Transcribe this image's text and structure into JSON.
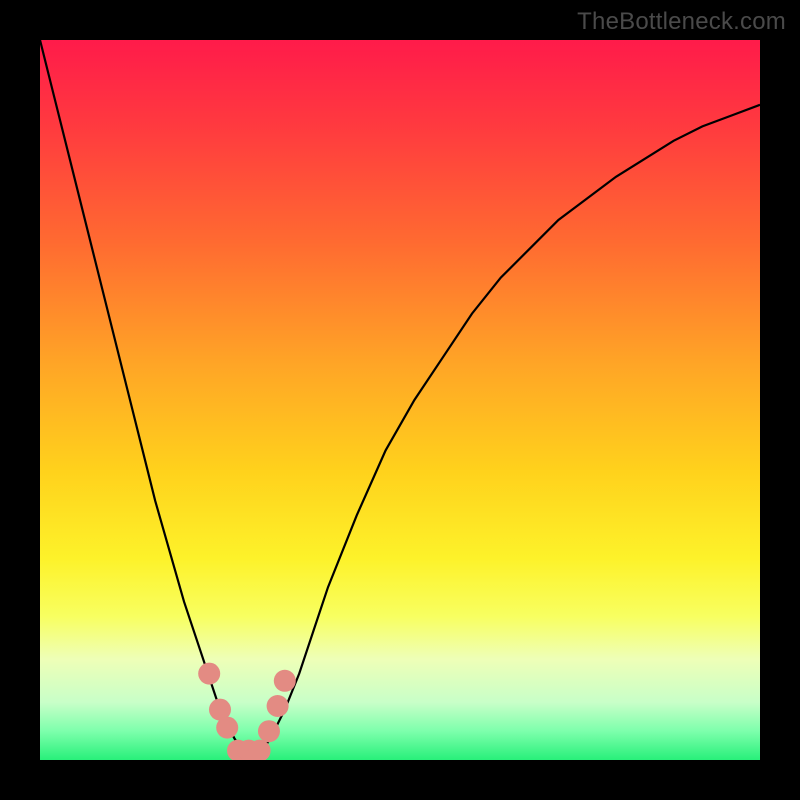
{
  "attribution": "TheBottleneck.com",
  "chart_data": {
    "type": "line",
    "title": "",
    "xlabel": "",
    "ylabel": "",
    "xlim": [
      0,
      100
    ],
    "ylim": [
      0,
      100
    ],
    "grid": false,
    "series": [
      {
        "name": "bottleneck-curve",
        "x": [
          0,
          2,
          4,
          6,
          8,
          10,
          12,
          14,
          16,
          18,
          20,
          22,
          24,
          25,
          26,
          27,
          28,
          29,
          30,
          31,
          32,
          34,
          36,
          38,
          40,
          44,
          48,
          52,
          56,
          60,
          64,
          68,
          72,
          76,
          80,
          84,
          88,
          92,
          96,
          100
        ],
        "y": [
          100,
          92,
          84,
          76,
          68,
          60,
          52,
          44,
          36,
          29,
          22,
          16,
          10,
          7,
          5,
          3,
          1.5,
          1,
          1,
          1.5,
          3,
          7,
          12,
          18,
          24,
          34,
          43,
          50,
          56,
          62,
          67,
          71,
          75,
          78,
          81,
          83.5,
          86,
          88,
          89.5,
          91
        ]
      }
    ],
    "markers": {
      "name": "highlight-points",
      "color": "#e38b83",
      "points": [
        {
          "x": 23.5,
          "y": 12
        },
        {
          "x": 25,
          "y": 7
        },
        {
          "x": 26,
          "y": 4.5
        },
        {
          "x": 27.5,
          "y": 1.3
        },
        {
          "x": 29,
          "y": 1.3
        },
        {
          "x": 30.5,
          "y": 1.3
        },
        {
          "x": 31.8,
          "y": 4
        },
        {
          "x": 33,
          "y": 7.5
        },
        {
          "x": 34,
          "y": 11
        }
      ]
    },
    "gradient_stops": [
      {
        "offset": 0.0,
        "color": "#ff1b4a"
      },
      {
        "offset": 0.12,
        "color": "#ff3a3f"
      },
      {
        "offset": 0.28,
        "color": "#ff6a31"
      },
      {
        "offset": 0.45,
        "color": "#ffa526"
      },
      {
        "offset": 0.6,
        "color": "#ffd21c"
      },
      {
        "offset": 0.72,
        "color": "#fdf22a"
      },
      {
        "offset": 0.8,
        "color": "#f8ff60"
      },
      {
        "offset": 0.86,
        "color": "#eeffb7"
      },
      {
        "offset": 0.92,
        "color": "#c8ffc8"
      },
      {
        "offset": 0.96,
        "color": "#7dffac"
      },
      {
        "offset": 1.0,
        "color": "#28f07a"
      }
    ]
  }
}
